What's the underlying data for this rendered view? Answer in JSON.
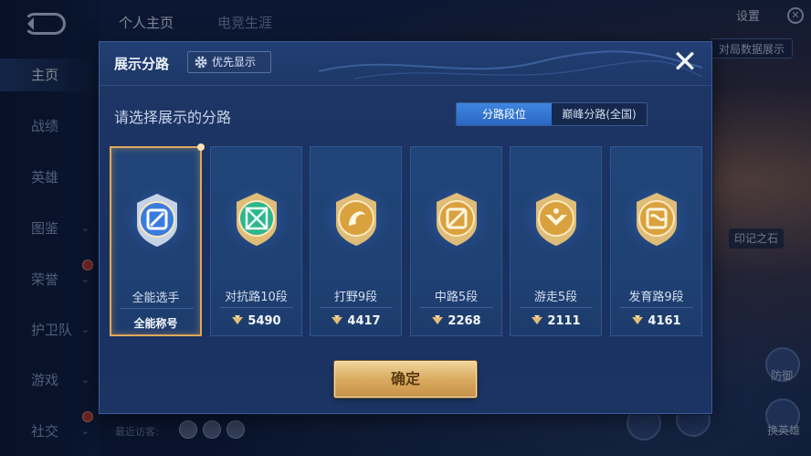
{
  "background": {
    "top_tabs": [
      "个人主页",
      "电竞生涯"
    ],
    "nav_items": [
      {
        "label": "主页",
        "active": true,
        "has_arrow": false,
        "badge": false
      },
      {
        "label": "战绩",
        "active": false,
        "has_arrow": false,
        "badge": false
      },
      {
        "label": "英雄",
        "active": false,
        "has_arrow": false,
        "badge": false
      },
      {
        "label": "图鉴",
        "active": false,
        "has_arrow": true,
        "badge": false
      },
      {
        "label": "荣誉",
        "active": false,
        "has_arrow": true,
        "badge": true
      },
      {
        "label": "护卫队",
        "active": false,
        "has_arrow": true,
        "badge": false
      },
      {
        "label": "游戏",
        "active": false,
        "has_arrow": true,
        "badge": false
      },
      {
        "label": "社交",
        "active": false,
        "has_arrow": true,
        "badge": true
      }
    ],
    "settings_label": "设置",
    "data_display_label": "对局数据展示",
    "stone_label": "印记之石",
    "bottom_label_1": "防御",
    "bottom_label_2": "换英雄",
    "visitors_label": "最近访客:"
  },
  "modal": {
    "title": "展示分路",
    "priority_label": "优先显示",
    "close_symbol": "✕",
    "prompt": "请选择展示的分路",
    "toggle_options": [
      {
        "label": "分路段位",
        "active": true
      },
      {
        "label": "巅峰分路(全国)",
        "active": false
      }
    ],
    "cards": [
      {
        "name": "全能选手",
        "score": "",
        "sublabel": "全能称号",
        "selected": true,
        "emblem": "all-round-emblem-icon",
        "gem": "#3a7be0"
      },
      {
        "name": "对抗路10段",
        "score": "5490",
        "sublabel": "",
        "selected": false,
        "emblem": "clash-lane-emblem-icon",
        "gem": "#2fb58a"
      },
      {
        "name": "打野9段",
        "score": "4417",
        "sublabel": "",
        "selected": false,
        "emblem": "jungle-emblem-icon",
        "gem": "#d9a23f"
      },
      {
        "name": "中路5段",
        "score": "2268",
        "sublabel": "",
        "selected": false,
        "emblem": "mid-lane-emblem-icon",
        "gem": "#d9a23f"
      },
      {
        "name": "游走5段",
        "score": "2111",
        "sublabel": "",
        "selected": false,
        "emblem": "roam-emblem-icon",
        "gem": "#d9a23f"
      },
      {
        "name": "发育路9段",
        "score": "4161",
        "sublabel": "",
        "selected": false,
        "emblem": "farm-lane-emblem-icon",
        "gem": "#d9a23f"
      }
    ],
    "confirm_label": "确定"
  },
  "colors": {
    "accent_blue": "#3e86e0",
    "gold": "#e0a959",
    "panel": "#1e3766"
  }
}
